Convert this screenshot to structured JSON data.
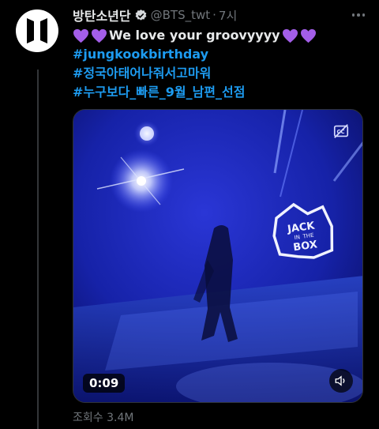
{
  "tweet": {
    "author_name": "방탄소년단",
    "handle": "@BTS_twt",
    "separator": "·",
    "timestamp": "7시",
    "text_main": "We love your groovyyyy",
    "hashtags": [
      "#jungkookbirthday",
      "#정국아태어나줘서고마워",
      "#누구보다_빠른_9월_남편_선점"
    ],
    "heart_color": "#a35ee8"
  },
  "video": {
    "duration": "0:09",
    "sign_text": [
      "JACK",
      "IN",
      "THE",
      "BOX"
    ]
  },
  "stats": {
    "views": "조회수 3.4M"
  },
  "colors": {
    "background": "#000000",
    "text_primary": "#e7e9ea",
    "text_secondary": "#71767b",
    "link": "#1d9bf0"
  }
}
